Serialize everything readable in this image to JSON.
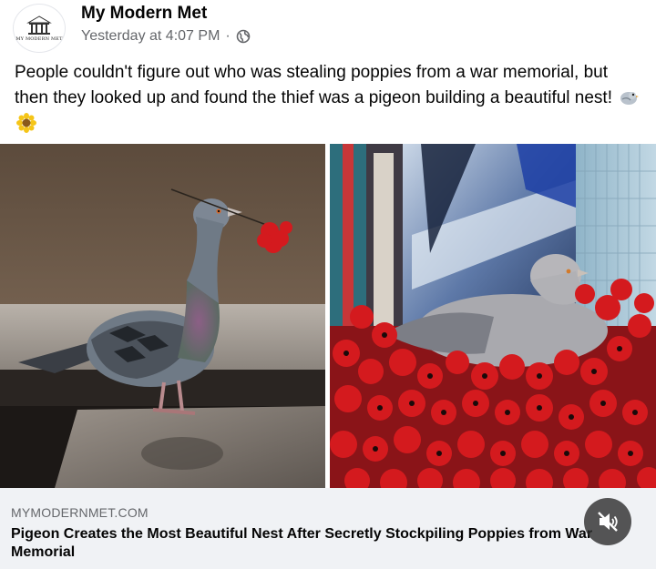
{
  "post": {
    "page_name": "My Modern Met",
    "avatar_text": "MY MODERN MET",
    "timestamp": "Yesterday at 4:07 PM",
    "separator": "·",
    "privacy_icon": "globe-icon",
    "caption": "People couldn't figure out who was stealing poppies from a war memorial, but then they looked up and found the thief was a pigeon building a beautiful nest!",
    "caption_emojis": [
      "bird-emoji",
      "sunflower-emoji"
    ]
  },
  "images": [
    {
      "name": "pigeon-holding-poppy-photo"
    },
    {
      "name": "pigeon-nest-of-poppies-photo"
    }
  ],
  "link_preview": {
    "domain": "MYMODERNMET.COM",
    "title": "Pigeon Creates the Most Beautiful Nest After Secretly Stockpiling Poppies from War Memorial"
  },
  "controls": {
    "mute_icon": "speaker-muted-icon"
  },
  "colors": {
    "text_primary": "#050505",
    "text_secondary": "#65676b",
    "link_bg": "#f0f2f5",
    "poppy_red": "#d41a1e"
  }
}
